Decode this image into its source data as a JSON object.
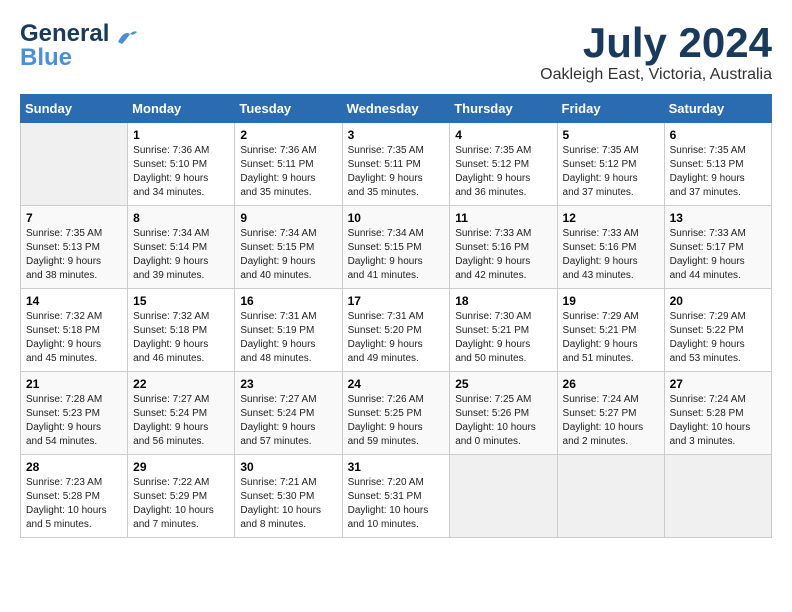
{
  "header": {
    "logo_line1": "General",
    "logo_line2": "Blue",
    "month": "July 2024",
    "location": "Oakleigh East, Victoria, Australia"
  },
  "weekdays": [
    "Sunday",
    "Monday",
    "Tuesday",
    "Wednesday",
    "Thursday",
    "Friday",
    "Saturday"
  ],
  "weeks": [
    [
      {
        "day": "",
        "info": ""
      },
      {
        "day": "1",
        "info": "Sunrise: 7:36 AM\nSunset: 5:10 PM\nDaylight: 9 hours\nand 34 minutes."
      },
      {
        "day": "2",
        "info": "Sunrise: 7:36 AM\nSunset: 5:11 PM\nDaylight: 9 hours\nand 35 minutes."
      },
      {
        "day": "3",
        "info": "Sunrise: 7:35 AM\nSunset: 5:11 PM\nDaylight: 9 hours\nand 35 minutes."
      },
      {
        "day": "4",
        "info": "Sunrise: 7:35 AM\nSunset: 5:12 PM\nDaylight: 9 hours\nand 36 minutes."
      },
      {
        "day": "5",
        "info": "Sunrise: 7:35 AM\nSunset: 5:12 PM\nDaylight: 9 hours\nand 37 minutes."
      },
      {
        "day": "6",
        "info": "Sunrise: 7:35 AM\nSunset: 5:13 PM\nDaylight: 9 hours\nand 37 minutes."
      }
    ],
    [
      {
        "day": "7",
        "info": "Sunrise: 7:35 AM\nSunset: 5:13 PM\nDaylight: 9 hours\nand 38 minutes."
      },
      {
        "day": "8",
        "info": "Sunrise: 7:34 AM\nSunset: 5:14 PM\nDaylight: 9 hours\nand 39 minutes."
      },
      {
        "day": "9",
        "info": "Sunrise: 7:34 AM\nSunset: 5:15 PM\nDaylight: 9 hours\nand 40 minutes."
      },
      {
        "day": "10",
        "info": "Sunrise: 7:34 AM\nSunset: 5:15 PM\nDaylight: 9 hours\nand 41 minutes."
      },
      {
        "day": "11",
        "info": "Sunrise: 7:33 AM\nSunset: 5:16 PM\nDaylight: 9 hours\nand 42 minutes."
      },
      {
        "day": "12",
        "info": "Sunrise: 7:33 AM\nSunset: 5:16 PM\nDaylight: 9 hours\nand 43 minutes."
      },
      {
        "day": "13",
        "info": "Sunrise: 7:33 AM\nSunset: 5:17 PM\nDaylight: 9 hours\nand 44 minutes."
      }
    ],
    [
      {
        "day": "14",
        "info": "Sunrise: 7:32 AM\nSunset: 5:18 PM\nDaylight: 9 hours\nand 45 minutes."
      },
      {
        "day": "15",
        "info": "Sunrise: 7:32 AM\nSunset: 5:18 PM\nDaylight: 9 hours\nand 46 minutes."
      },
      {
        "day": "16",
        "info": "Sunrise: 7:31 AM\nSunset: 5:19 PM\nDaylight: 9 hours\nand 48 minutes."
      },
      {
        "day": "17",
        "info": "Sunrise: 7:31 AM\nSunset: 5:20 PM\nDaylight: 9 hours\nand 49 minutes."
      },
      {
        "day": "18",
        "info": "Sunrise: 7:30 AM\nSunset: 5:21 PM\nDaylight: 9 hours\nand 50 minutes."
      },
      {
        "day": "19",
        "info": "Sunrise: 7:29 AM\nSunset: 5:21 PM\nDaylight: 9 hours\nand 51 minutes."
      },
      {
        "day": "20",
        "info": "Sunrise: 7:29 AM\nSunset: 5:22 PM\nDaylight: 9 hours\nand 53 minutes."
      }
    ],
    [
      {
        "day": "21",
        "info": "Sunrise: 7:28 AM\nSunset: 5:23 PM\nDaylight: 9 hours\nand 54 minutes."
      },
      {
        "day": "22",
        "info": "Sunrise: 7:27 AM\nSunset: 5:24 PM\nDaylight: 9 hours\nand 56 minutes."
      },
      {
        "day": "23",
        "info": "Sunrise: 7:27 AM\nSunset: 5:24 PM\nDaylight: 9 hours\nand 57 minutes."
      },
      {
        "day": "24",
        "info": "Sunrise: 7:26 AM\nSunset: 5:25 PM\nDaylight: 9 hours\nand 59 minutes."
      },
      {
        "day": "25",
        "info": "Sunrise: 7:25 AM\nSunset: 5:26 PM\nDaylight: 10 hours\nand 0 minutes."
      },
      {
        "day": "26",
        "info": "Sunrise: 7:24 AM\nSunset: 5:27 PM\nDaylight: 10 hours\nand 2 minutes."
      },
      {
        "day": "27",
        "info": "Sunrise: 7:24 AM\nSunset: 5:28 PM\nDaylight: 10 hours\nand 3 minutes."
      }
    ],
    [
      {
        "day": "28",
        "info": "Sunrise: 7:23 AM\nSunset: 5:28 PM\nDaylight: 10 hours\nand 5 minutes."
      },
      {
        "day": "29",
        "info": "Sunrise: 7:22 AM\nSunset: 5:29 PM\nDaylight: 10 hours\nand 7 minutes."
      },
      {
        "day": "30",
        "info": "Sunrise: 7:21 AM\nSunset: 5:30 PM\nDaylight: 10 hours\nand 8 minutes."
      },
      {
        "day": "31",
        "info": "Sunrise: 7:20 AM\nSunset: 5:31 PM\nDaylight: 10 hours\nand 10 minutes."
      },
      {
        "day": "",
        "info": ""
      },
      {
        "day": "",
        "info": ""
      },
      {
        "day": "",
        "info": ""
      }
    ]
  ]
}
